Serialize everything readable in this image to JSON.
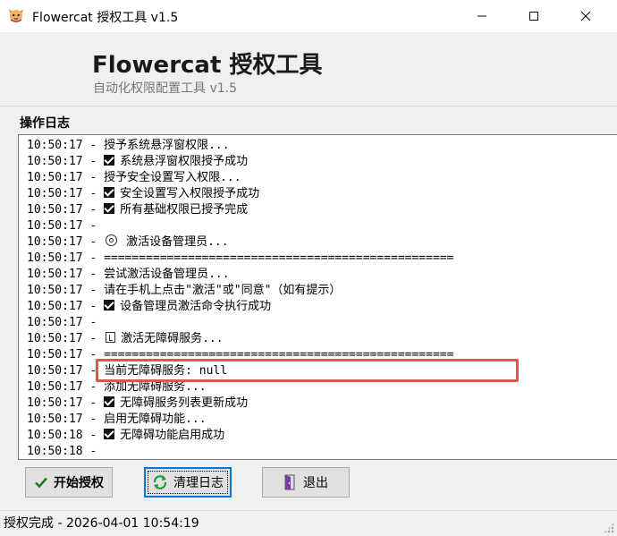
{
  "window": {
    "title": "Flowercat 授权工具 v1.5",
    "app_icon": "cat-face-icon",
    "minimize_icon": "minimize-icon",
    "maximize_icon": "maximize-icon",
    "close_icon": "close-icon"
  },
  "banner": {
    "title": "Flowercat 授权工具",
    "subtitle": "自动化权限配置工具 v1.5"
  },
  "log": {
    "label": "操作日志",
    "lines": [
      {
        "time": "10:50:17",
        "icon": "",
        "text": "授予系统悬浮窗权限..."
      },
      {
        "time": "10:50:17",
        "icon": "check",
        "text": "系统悬浮窗权限授予成功"
      },
      {
        "time": "10:50:17",
        "icon": "",
        "text": "授予安全设置写入权限..."
      },
      {
        "time": "10:50:17",
        "icon": "check",
        "text": "安全设置写入权限授予成功"
      },
      {
        "time": "10:50:17",
        "icon": "check",
        "text": "所有基础权限已授予完成"
      },
      {
        "time": "10:50:17",
        "icon": "",
        "text": ""
      },
      {
        "time": "10:50:17",
        "icon": "gear",
        "text": "激活设备管理员..."
      },
      {
        "time": "10:50:17",
        "icon": "",
        "text": "=================================================="
      },
      {
        "time": "10:50:17",
        "icon": "",
        "text": "尝试激活设备管理员..."
      },
      {
        "time": "10:50:17",
        "icon": "",
        "text": "请在手机上点击\"激活\"或\"同意\"（如有提示）"
      },
      {
        "time": "10:50:17",
        "icon": "check",
        "text": "设备管理员激活命令执行成功"
      },
      {
        "time": "10:50:17",
        "icon": "",
        "text": ""
      },
      {
        "time": "10:50:17",
        "icon": "accessibility",
        "text": "激活无障碍服务..."
      },
      {
        "time": "10:50:17",
        "icon": "",
        "text": "=================================================="
      },
      {
        "time": "10:50:17",
        "icon": "",
        "text": "当前无障碍服务: null"
      },
      {
        "time": "10:50:17",
        "icon": "",
        "text": "添加无障碍服务..."
      },
      {
        "time": "10:50:17",
        "icon": "check",
        "text": "无障碍服务列表更新成功"
      },
      {
        "time": "10:50:17",
        "icon": "",
        "text": "启用无障碍功能..."
      },
      {
        "time": "10:50:18",
        "icon": "check",
        "text": "无障碍功能启用成功"
      },
      {
        "time": "10:50:18",
        "icon": "",
        "text": ""
      }
    ],
    "highlight_color": "#e8504f"
  },
  "buttons": {
    "start_label": "开始授权",
    "start_icon": "checkmark-icon",
    "clear_label": "清理日志",
    "clear_icon": "refresh-icon",
    "exit_label": "退出",
    "exit_icon": "exit-door-icon"
  },
  "status": {
    "text": "授权完成 - 2026-04-01 10:54:19"
  }
}
